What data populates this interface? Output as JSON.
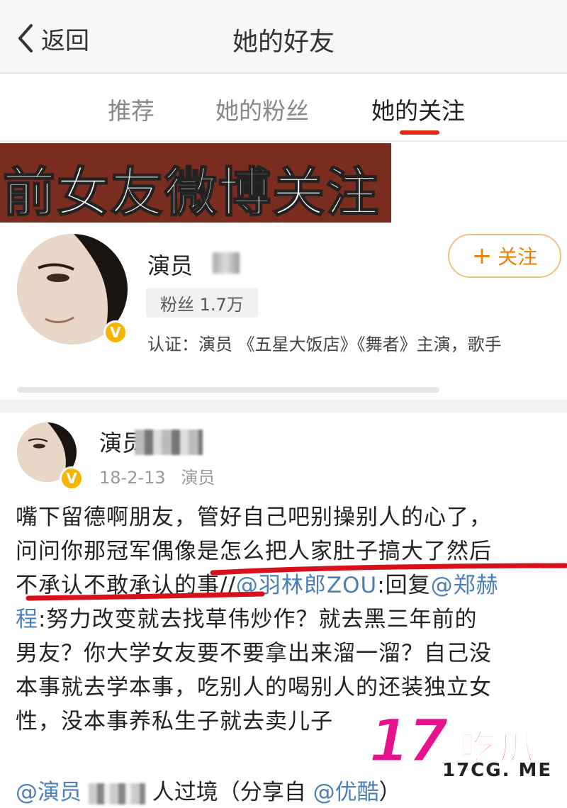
{
  "header": {
    "back_label": "返回",
    "title": "她的好友"
  },
  "tabs": [
    {
      "label": "推荐"
    },
    {
      "label": "她的粉丝"
    },
    {
      "label": "她的关注"
    }
  ],
  "banner": {
    "text": "前女友微博关注"
  },
  "user_card": {
    "name": "演员",
    "follow_label": "关注",
    "fans": "粉丝 1.7万",
    "verification": "认证：演员 《五星大饭店》《舞者》主演，歌手"
  },
  "post": {
    "author": "演员",
    "date": "18-2-13",
    "source": "演员",
    "text_line1": "嘴下留德啊朋友，管好自己吧别操别人的心了，",
    "text_line2": "问问你那冠军偶像是怎么把人家肚子搞大了然后",
    "text_line3a": "不承认不敢承认的事//",
    "text_line3_mention": "@羽林郎ZOU",
    "text_line3b": ":回复",
    "text_line3_mention2": "@郑赫",
    "text_line4_mention": "程",
    "text_line4": ":努力改变就去找草伟炒作？就去黑三年前的",
    "text_line5": "男友？你大学女友要不要拿出来溜一溜？自己没",
    "text_line6": "本事就去学本事，吃别人的喝别人的还装独立女",
    "text_line7": "性，没本事养私生子就去卖儿子",
    "bottom_mention": "@演员",
    "bottom_text": "人过境（分享自 ",
    "bottom_mention2": "@优酷",
    "bottom_close": "）"
  },
  "watermark": {
    "number": "17",
    "name": "吃瓜",
    "url": "17CG. ME"
  },
  "colors": {
    "accent_red": "#e02a12",
    "follow_orange": "#f08000",
    "link_blue": "#4a7fb8",
    "verified_gold": "#f5b400",
    "watermark_pink": "#e8118d"
  }
}
